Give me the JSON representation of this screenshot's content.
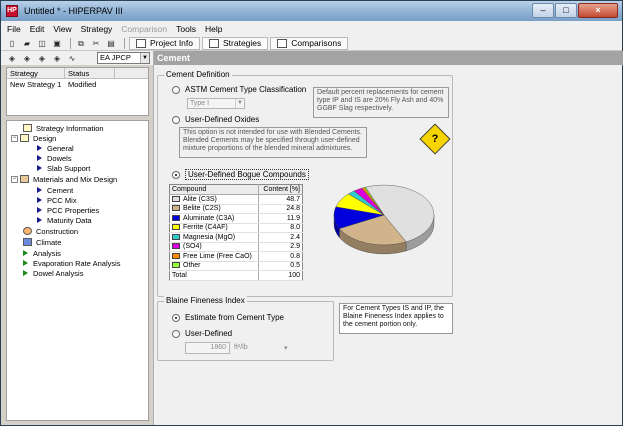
{
  "window": {
    "title": "Untitled * - HIPERPAV III",
    "app_icon": "HP"
  },
  "menu": [
    "File",
    "Edit",
    "View",
    "Strategy",
    "Comparison",
    "Tools",
    "Help"
  ],
  "toolbar": {
    "tabs": [
      {
        "label": "Project Info",
        "icon": "info-icon"
      },
      {
        "label": "Strategies",
        "icon": "strategies-icon"
      },
      {
        "label": "Comparisons",
        "icon": "chart-icon"
      }
    ],
    "strategy_select": "EA JPCP"
  },
  "strategy_list": {
    "headers": [
      "Strategy",
      "Status"
    ],
    "rows": [
      {
        "name": "New Strategy 1",
        "status": "Modified"
      }
    ]
  },
  "tree": [
    {
      "label": "Strategy Information",
      "level": 0,
      "kind": "doc"
    },
    {
      "label": "Design",
      "level": 0,
      "kind": "folder"
    },
    {
      "label": "General",
      "level": 1,
      "kind": "item"
    },
    {
      "label": "Dowels",
      "level": 1,
      "kind": "item"
    },
    {
      "label": "Slab Support",
      "level": 1,
      "kind": "item"
    },
    {
      "label": "Materials and Mix Design",
      "level": 0,
      "kind": "folder-mat"
    },
    {
      "label": "Cement",
      "level": 1,
      "kind": "item"
    },
    {
      "label": "PCC Mix",
      "level": 1,
      "kind": "item"
    },
    {
      "label": "PCC Properties",
      "level": 1,
      "kind": "item"
    },
    {
      "label": "Maturity Data",
      "level": 1,
      "kind": "item"
    },
    {
      "label": "Construction",
      "level": 0,
      "kind": "cons"
    },
    {
      "label": "Climate",
      "level": 0,
      "kind": "clim"
    },
    {
      "label": "Analysis",
      "level": 0,
      "kind": "green"
    },
    {
      "label": "Evaporation Rate Analysis",
      "level": 0,
      "kind": "green"
    },
    {
      "label": "Dowel Analysis",
      "level": 0,
      "kind": "green"
    }
  ],
  "content": {
    "header": "Cement",
    "definition": {
      "group_label": "Cement Definition",
      "astm_label": "ASTM Cement Type Classification",
      "astm_value": "Type I",
      "astm_note": "Default percent replacements for cement type IP and IS are 20% Fly Ash and 40% GGBF Slag respectively.",
      "oxides_label": "User-Defined Oxides",
      "oxides_note": "This option is not intended for use with Blended Cements. Blended Cements may be specified through user-defined mixture proportions of the blended mineral admixtures.",
      "bogue_label": "User-Defined Bogue Compounds",
      "help_label": "?"
    },
    "compounds": {
      "headers": [
        "Compound",
        "Content [%]"
      ],
      "rows": [
        {
          "name": "Alite (C3S)",
          "value": "48.7",
          "color": "#e0e0e0"
        },
        {
          "name": "Belite (C2S)",
          "value": "24.8",
          "color": "#d2b48c"
        },
        {
          "name": "Aluminate (C3A)",
          "value": "11.9",
          "color": "#0000dd"
        },
        {
          "name": "Ferrite (C4AF)",
          "value": "8.0",
          "color": "#ffff00"
        },
        {
          "name": "Magnesia (MgO)",
          "value": "2.4",
          "color": "#33cccc"
        },
        {
          "name": "(SO4)",
          "value": "2.9",
          "color": "#dd00dd"
        },
        {
          "name": "Free Lime (Free CaO)",
          "value": "0.8",
          "color": "#ff8c00"
        },
        {
          "name": "Other",
          "value": "0.5",
          "color": "#99ff33"
        }
      ],
      "total_label": "Total",
      "total_value": "100"
    },
    "chart_data": {
      "type": "pie",
      "categories": [
        "Alite (C3S)",
        "Belite (C2S)",
        "Aluminate (C3A)",
        "Ferrite (C4AF)",
        "Magnesia (MgO)",
        "(SO4)",
        "Free Lime (Free CaO)",
        "Other"
      ],
      "values": [
        48.7,
        24.8,
        11.9,
        8.0,
        2.4,
        2.9,
        0.8,
        0.5
      ],
      "colors": [
        "#e0e0e0",
        "#d2b48c",
        "#0000dd",
        "#ffff00",
        "#33cccc",
        "#dd00dd",
        "#ff8c00",
        "#99ff33"
      ]
    },
    "blaine": {
      "group_label": "Blaine Fineness Index",
      "estimate_label": "Estimate from Cement Type",
      "user_label": "User-Defined",
      "value": "1860",
      "unit": "ft²/lb",
      "note": "For Cement Types IS and IP, the Blaine Fineness Index applies to the cement portion only."
    }
  }
}
